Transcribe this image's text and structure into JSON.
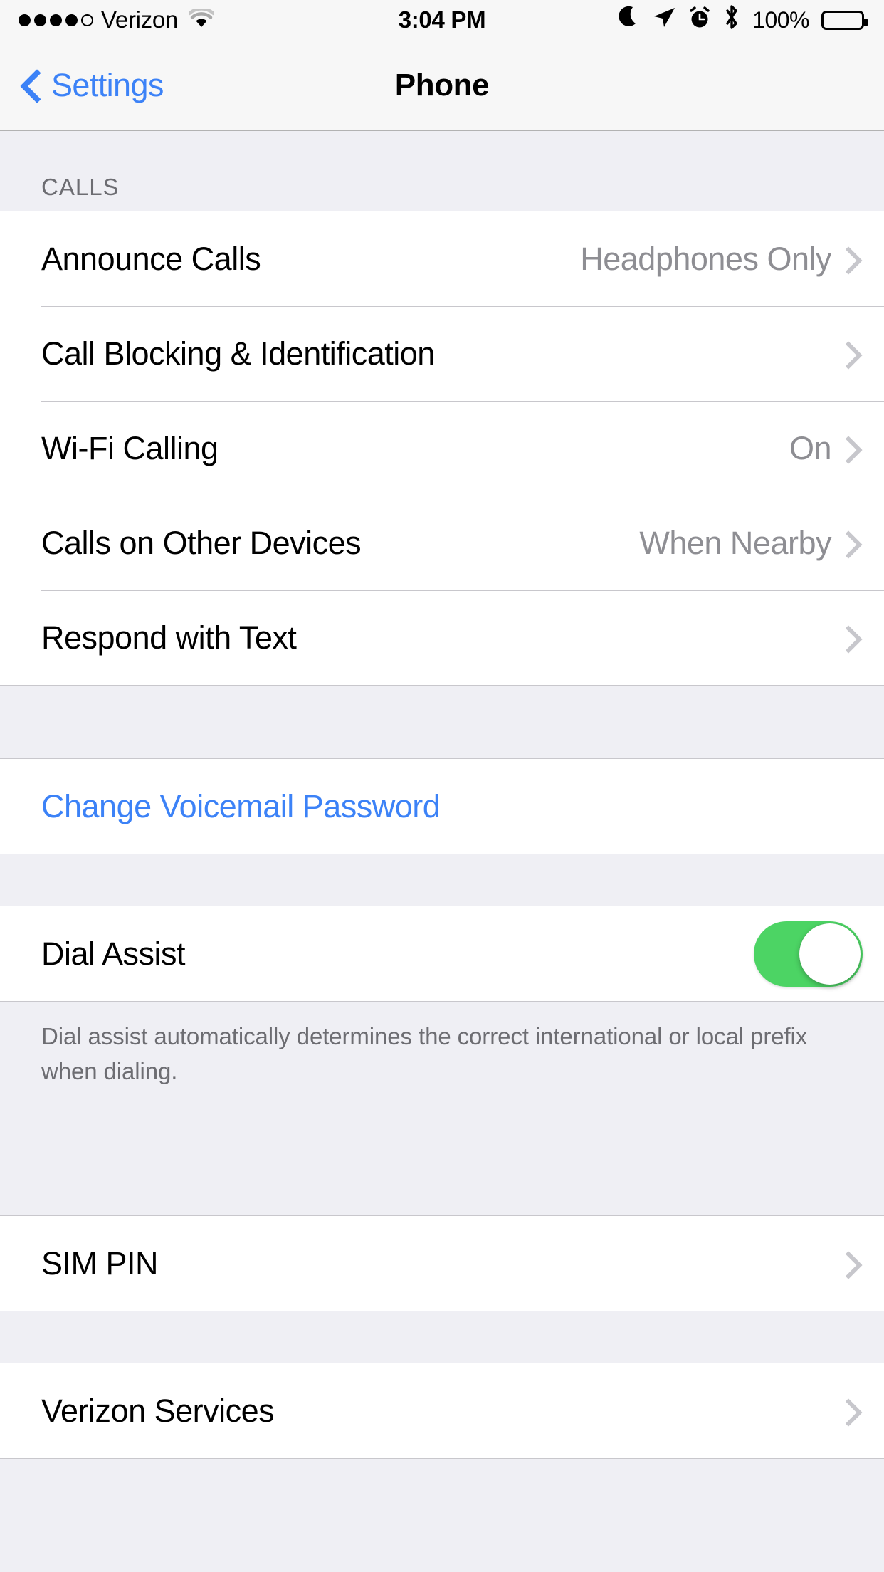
{
  "status_bar": {
    "carrier": "Verizon",
    "signal_bars_filled": 4,
    "signal_bars_total": 5,
    "wifi_icon": "wifi-icon",
    "time": "3:04 PM",
    "icons": [
      "do-not-disturb-moon-icon",
      "location-arrow-icon",
      "alarm-clock-icon",
      "bluetooth-icon"
    ],
    "battery_percent": "100%",
    "battery_level": 100
  },
  "nav_bar": {
    "back_label": "Settings",
    "title": "Phone"
  },
  "sections": [
    {
      "header": "CALLS",
      "rows": [
        {
          "label": "Announce Calls",
          "value": "Headphones Only",
          "accessory": "chevron"
        },
        {
          "label": "Call Blocking & Identification",
          "value": "",
          "accessory": "chevron"
        },
        {
          "label": "Wi-Fi Calling",
          "value": "On",
          "accessory": "chevron"
        },
        {
          "label": "Calls on Other Devices",
          "value": "When Nearby",
          "accessory": "chevron"
        },
        {
          "label": "Respond with Text",
          "value": "",
          "accessory": "chevron"
        }
      ]
    },
    {
      "header": "",
      "rows": [
        {
          "label": "Change Voicemail Password",
          "value": "",
          "accessory": "none",
          "style": "link"
        }
      ]
    },
    {
      "header": "",
      "rows": [
        {
          "label": "Dial Assist",
          "value": "",
          "accessory": "toggle",
          "toggle_on": true
        }
      ],
      "footer": "Dial assist automatically determines the correct international or local prefix when dialing."
    },
    {
      "header": "",
      "rows": [
        {
          "label": "SIM PIN",
          "value": "",
          "accessory": "chevron"
        }
      ]
    },
    {
      "header": "",
      "rows": [
        {
          "label": "Verizon Services",
          "value": "",
          "accessory": "chevron"
        }
      ]
    }
  ],
  "colors": {
    "accent_blue": "#3C82F7",
    "toggle_green": "#4CD464",
    "group_bg": "#FFFFFF",
    "page_bg": "#EFEFF4",
    "separator": "#C8C7CC",
    "secondary_text": "#8E8E93",
    "header_text": "#6D6D72"
  }
}
